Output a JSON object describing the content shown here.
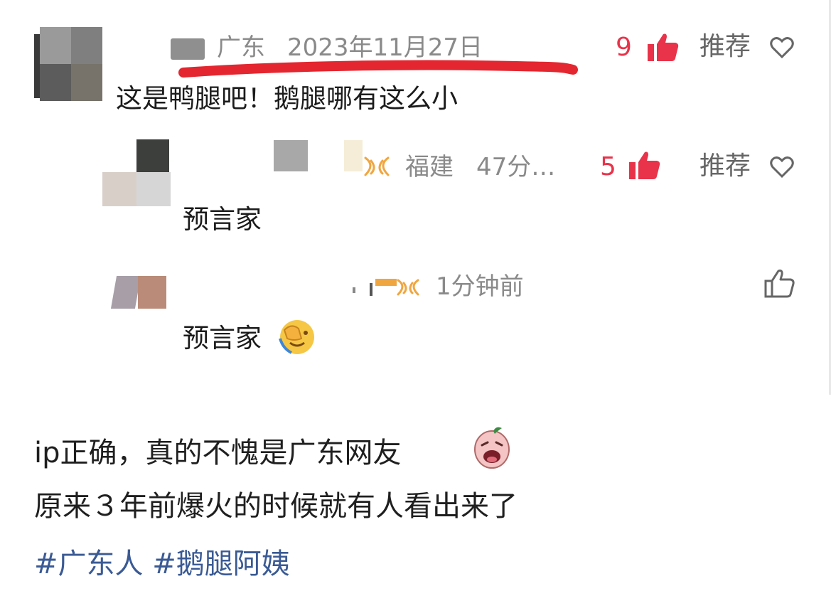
{
  "comment1": {
    "location": "广东",
    "date": "2023年11月27日",
    "like_count": "9",
    "recommend_label": "推荐",
    "text": "这是鸭腿吧！鹅腿哪有这么小"
  },
  "reply1": {
    "location": "福建",
    "time": "47分…",
    "like_count": "5",
    "recommend_label": "推荐",
    "text": "预言家"
  },
  "reply2": {
    "time": "1分钟前",
    "text": "预言家"
  },
  "caption": {
    "line1": "ip正确，真的不愧是广东网友",
    "line2": "原来３年前爆火的时候就有人看出来了",
    "tag1": "#广东人",
    "tag2": "#鹅腿阿姨"
  },
  "colors": {
    "like_red": "#e8334a",
    "underline_red": "#e3262f",
    "hashtag_blue": "#3a5a94",
    "meta_gray": "#8a8a8a"
  },
  "icons": [
    "thumbs-up-filled-icon",
    "heart-outline-icon",
    "thumbs-up-outline-icon",
    "face-palm-emoji-icon",
    "crying-face-emoji-icon",
    "badge-icon"
  ]
}
